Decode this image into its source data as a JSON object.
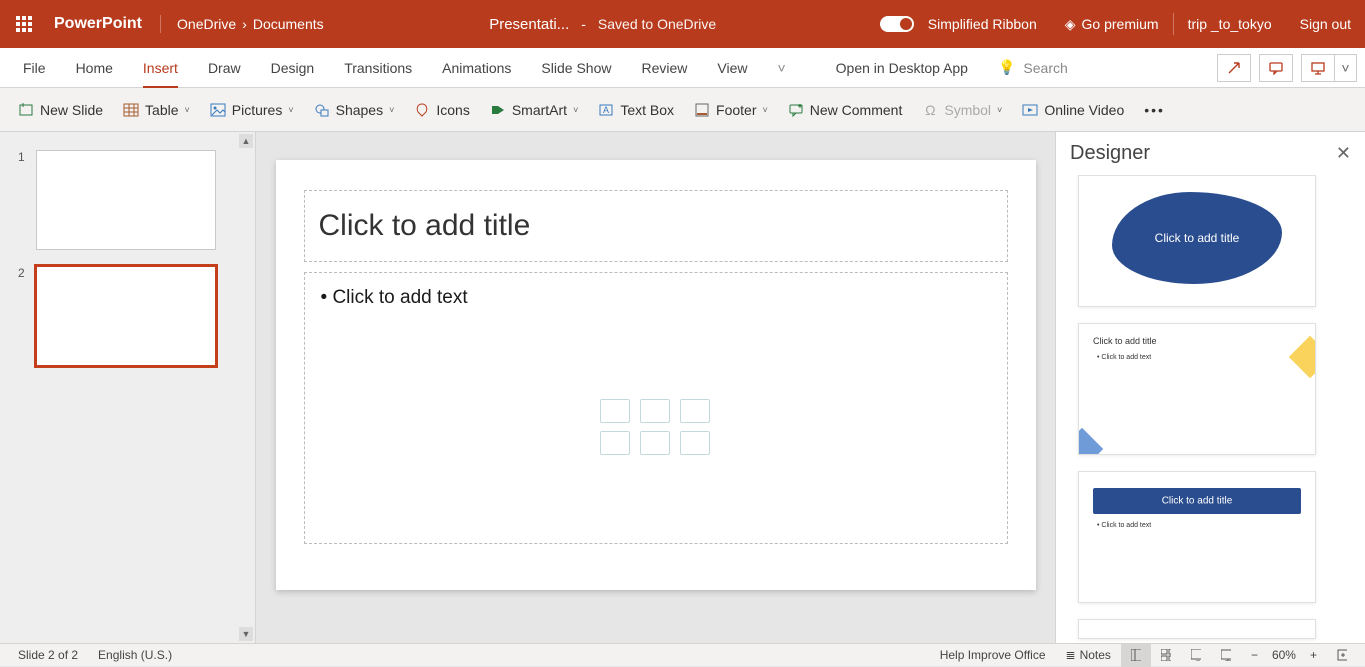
{
  "titlebar": {
    "app": "PowerPoint",
    "breadcrumb": [
      "OneDrive",
      "Documents"
    ],
    "doc_title": "Presentati...",
    "saved_status": "Saved to OneDrive",
    "simplified_ribbon": "Simplified Ribbon",
    "go_premium": "Go premium",
    "username": "trip _to_tokyo",
    "sign_out": "Sign out"
  },
  "tabs": {
    "items": [
      "File",
      "Home",
      "Insert",
      "Draw",
      "Design",
      "Transitions",
      "Animations",
      "Slide Show",
      "Review",
      "View"
    ],
    "active_index": 2,
    "open_desktop": "Open in Desktop App",
    "search_placeholder": "Search"
  },
  "toolbar": {
    "new_slide": "New Slide",
    "table": "Table",
    "pictures": "Pictures",
    "shapes": "Shapes",
    "icons": "Icons",
    "smartart": "SmartArt",
    "textbox": "Text Box",
    "footer": "Footer",
    "new_comment": "New Comment",
    "symbol": "Symbol",
    "online_video": "Online Video"
  },
  "thumbs": {
    "items": [
      {
        "num": "1",
        "selected": false
      },
      {
        "num": "2",
        "selected": true
      }
    ]
  },
  "slide": {
    "title_placeholder": "Click to add title",
    "body_placeholder": "Click to add text"
  },
  "designer": {
    "title": "Designer",
    "suggestion_title": "Click to add title",
    "suggestion_body": "Click to add text"
  },
  "statusbar": {
    "slide_info": "Slide 2 of 2",
    "language": "English (U.S.)",
    "help_improve": "Help Improve Office",
    "notes": "Notes",
    "zoom": "60%"
  }
}
